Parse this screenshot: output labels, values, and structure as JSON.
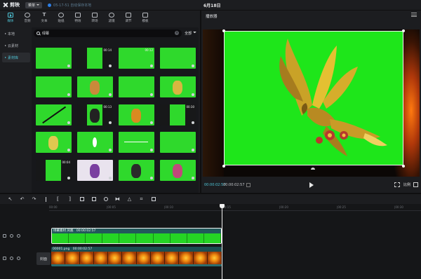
{
  "app": {
    "logo_text": "剪映",
    "menu_label": "菜单",
    "info_text": "05-17-51 自动保存本地",
    "project_title": "6月18日"
  },
  "tabs": [
    {
      "label": "媒体",
      "icon": "media-icon",
      "active": true
    },
    {
      "label": "音频",
      "icon": "audio-icon"
    },
    {
      "label": "文本",
      "icon": "text-icon"
    },
    {
      "label": "贴纸",
      "icon": "sticker-icon"
    },
    {
      "label": "特效",
      "icon": "effects-icon"
    },
    {
      "label": "转场",
      "icon": "transition-icon"
    },
    {
      "label": "滤镜",
      "icon": "filter-icon"
    },
    {
      "label": "调节",
      "icon": "adjust-icon"
    },
    {
      "label": "模板",
      "icon": "template-icon"
    }
  ],
  "side_nav": [
    {
      "label": "本地",
      "active": false
    },
    {
      "label": "云素材",
      "active": false
    },
    {
      "label": "素材库",
      "active": true
    }
  ],
  "search": {
    "value": "绿幕",
    "filter_label": "全部"
  },
  "thumbnails": [
    {
      "duration": "",
      "variant": "full"
    },
    {
      "duration": "00:14",
      "variant": "narrow"
    },
    {
      "duration": "00:12",
      "variant": "full"
    },
    {
      "duration": "",
      "variant": "full"
    },
    {
      "duration": "",
      "variant": "full"
    },
    {
      "duration": "",
      "variant": "tiger"
    },
    {
      "duration": "",
      "variant": "full"
    },
    {
      "duration": "",
      "variant": "dragon"
    },
    {
      "duration": "",
      "variant": "diagonal"
    },
    {
      "duration": "00:13",
      "variant": "person"
    },
    {
      "duration": "",
      "variant": "butterfly"
    },
    {
      "duration": "00:30",
      "variant": "narrow"
    },
    {
      "duration": "",
      "variant": "snake"
    },
    {
      "duration": "",
      "variant": "sparkle"
    },
    {
      "duration": "",
      "variant": "wave"
    },
    {
      "duration": "",
      "variant": "full"
    },
    {
      "duration": "00:04",
      "variant": "narrow"
    },
    {
      "duration": "",
      "variant": "anime"
    },
    {
      "duration": "",
      "variant": "man"
    },
    {
      "duration": "",
      "variant": "girl"
    }
  ],
  "player": {
    "title": "播放器",
    "current_time": "00:00:02:57",
    "total_time": "00:00:02:57",
    "ratio_label": "比例"
  },
  "timeline": {
    "ticks": [
      "00:00",
      "|00:05",
      "|00:10",
      "|00:15",
      "|00:20",
      "|00:25",
      "|00:30"
    ],
    "cover_label": "封面",
    "green_clip_label": "绿幕素材 凤凰　00:00:02:57",
    "fire_clip_label": "00001.png　00:00:02:57"
  },
  "colors": {
    "accent": "#4fc6d8",
    "green_screen": "#1ee61a"
  }
}
